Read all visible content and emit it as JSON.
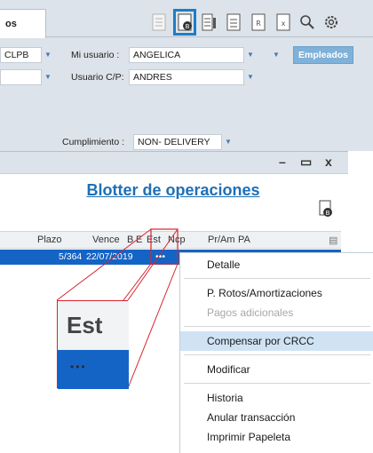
{
  "top": {
    "tab_label": "os",
    "currency_value": "CLPB",
    "mi_usuario_label": "Mi usuario :",
    "mi_usuario_value": "ANGELICA",
    "usuario_cp_label": "Usuario C/P:",
    "usuario_cp_value": "ANDRES",
    "empleados_button": "Empleados",
    "cumplimiento_label": "Cumplimiento :",
    "cumplimiento_value": "NON- DELIVERY"
  },
  "blotter": {
    "title": "Blotter de operaciones",
    "window_controls": {
      "minimize": "–",
      "restore": "▭",
      "close": "x"
    },
    "columns": [
      "Plazo",
      "Vence",
      "B",
      "E",
      "Est",
      "Ncp",
      "Pr/Am",
      "PA"
    ],
    "selected_row": {
      "plazo": "5/364",
      "vence": "22/07/2019",
      "est": "•••"
    }
  },
  "zoom": {
    "header_text": "Est",
    "cell_text": "•••"
  },
  "context_menu": {
    "items": [
      {
        "label": "Detalle",
        "disabled": false
      },
      {
        "label": "P. Rotos/Amortizaciones",
        "disabled": false
      },
      {
        "label": "Pagos adicionales",
        "disabled": true
      },
      {
        "label": "Compensar por CRCC",
        "disabled": false,
        "hover": true
      },
      {
        "label": "Modificar",
        "disabled": false
      },
      {
        "label": "Historia",
        "disabled": false
      },
      {
        "label": "Anular transacción",
        "disabled": false
      },
      {
        "label": "Imprimir Papeleta",
        "disabled": false
      }
    ]
  },
  "colors": {
    "selection": "#1464c6",
    "title": "#1e6fb5",
    "callout": "#d9232e",
    "highlight_outline": "#1d7ec8"
  }
}
